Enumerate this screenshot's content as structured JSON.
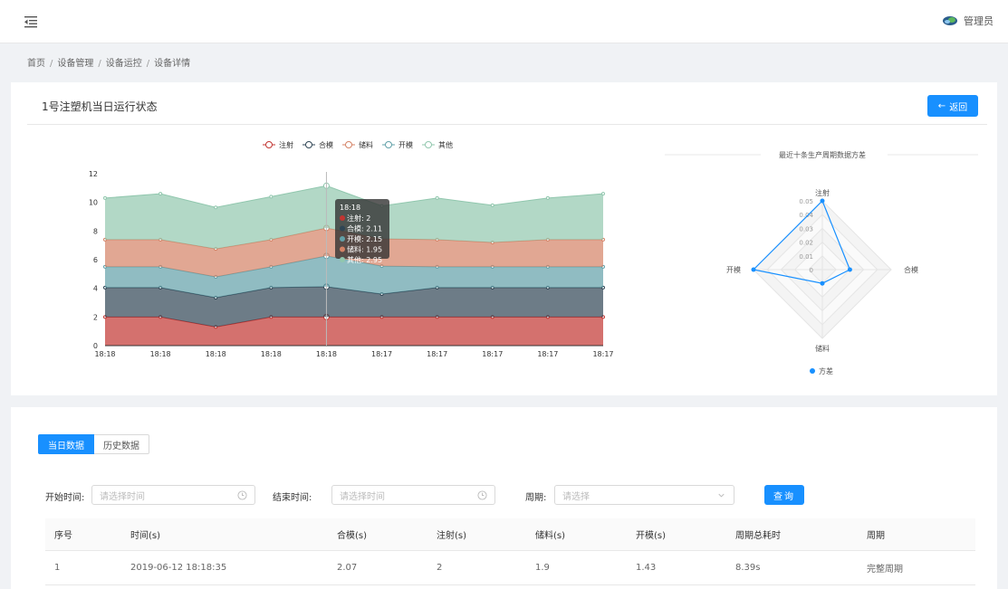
{
  "header": {
    "user_name": "管理员"
  },
  "breadcrumb": [
    "首页",
    "设备管理",
    "设备运控",
    "设备详情"
  ],
  "panel": {
    "title": "1号注塑机当日运行状态",
    "back_label": "返回"
  },
  "tooltip": {
    "title": "18:18",
    "items": [
      {
        "label": "注射: 2",
        "color": "#c23531"
      },
      {
        "label": "合模: 2.11",
        "color": "#2f4554"
      },
      {
        "label": "开模: 2.15",
        "color": "#61a0a8"
      },
      {
        "label": "储料: 1.95",
        "color": "#d48265"
      },
      {
        "label": "其他: 2.95",
        "color": "#91c7ae"
      }
    ]
  },
  "chart_data": [
    {
      "type": "area",
      "stacked": true,
      "categories": [
        "18:18",
        "18:18",
        "18:18",
        "18:18",
        "18:18",
        "18:17",
        "18:17",
        "18:17",
        "18:17",
        "18:17"
      ],
      "series": [
        {
          "name": "注射",
          "color": "#c23531",
          "values": [
            2,
            2,
            1.3,
            2,
            2,
            2,
            2,
            2,
            2,
            2
          ]
        },
        {
          "name": "合模",
          "color": "#2f4554",
          "values": [
            2.05,
            2.05,
            2.05,
            2.05,
            2.11,
            1.6,
            2.05,
            2.05,
            2.05,
            2.05
          ]
        },
        {
          "name": "开模",
          "color": "#61a0a8",
          "values": [
            1.45,
            1.45,
            1.45,
            1.45,
            2.15,
            1.95,
            1.45,
            1.45,
            1.45,
            1.45
          ]
        },
        {
          "name": "储料",
          "color": "#d48265",
          "values": [
            1.9,
            1.9,
            1.95,
            1.9,
            1.95,
            1.9,
            1.9,
            1.7,
            1.9,
            1.9
          ]
        },
        {
          "name": "其他",
          "color": "#91c7ae",
          "values": [
            2.9,
            3.2,
            2.9,
            3.0,
            2.95,
            2.3,
            2.9,
            2.6,
            2.9,
            3.2
          ]
        }
      ],
      "legend": [
        "注射",
        "合模",
        "储料",
        "开模",
        "其他"
      ],
      "legend_position": "top",
      "ylim": [
        0,
        12
      ],
      "yticks": [
        0,
        2,
        4,
        6,
        8,
        10,
        12
      ],
      "grid": false
    },
    {
      "type": "radar",
      "title": "最近十条生产周期数据方差",
      "indicators": [
        "注射",
        "合模",
        "储料",
        "开模"
      ],
      "rticks": [
        "0",
        "0.01",
        "0.02",
        "0.03",
        "0.04",
        "0.05"
      ],
      "rmax": 0.05,
      "series": [
        {
          "name": "方差",
          "color": "#1890ff",
          "values": [
            0.05,
            0.02,
            0.01,
            0.05
          ]
        }
      ]
    }
  ],
  "tabs": [
    "当日数据",
    "历史数据"
  ],
  "filters": {
    "start_label": "开始时间:",
    "start_placeholder": "请选择时间",
    "end_label": "结束时间:",
    "end_placeholder": "请选择时间",
    "period_label": "周期:",
    "period_placeholder": "请选择",
    "query_label": "查询"
  },
  "table": {
    "columns": [
      "序号",
      "时间(s)",
      "合模(s)",
      "注射(s)",
      "储料(s)",
      "开模(s)",
      "周期总耗时",
      "周期"
    ],
    "rows": [
      [
        "1",
        "2019-06-12 18:18:35",
        "2.07",
        "2",
        "1.9",
        "1.43",
        "8.39s",
        "完整周期"
      ]
    ]
  },
  "colors": {
    "primary": "#1890ff"
  }
}
